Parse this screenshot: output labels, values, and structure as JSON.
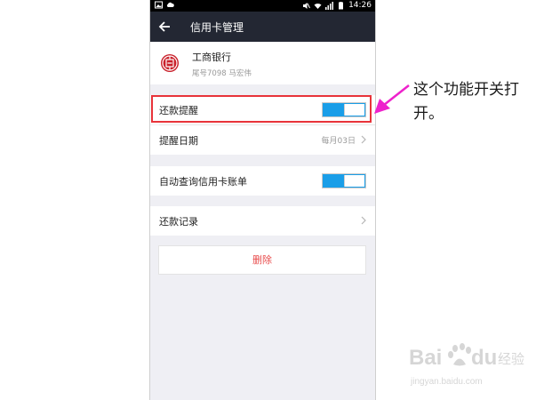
{
  "status_bar": {
    "time": "14:26"
  },
  "header": {
    "title": "信用卡管理"
  },
  "bank": {
    "name": "工商银行",
    "detail": "尾号7098 马宏伟",
    "logo_glyph": "国"
  },
  "settings": {
    "repayment_reminder": {
      "label": "还款提醒",
      "enabled": true
    },
    "reminder_date": {
      "label": "提醒日期",
      "value": "每月03日"
    },
    "auto_query": {
      "label": "自动查询信用卡账单",
      "enabled": true
    },
    "repayment_records": {
      "label": "还款记录"
    }
  },
  "delete_button": {
    "label": "删除"
  },
  "annotation": {
    "text": "这个功能开关打开。"
  },
  "watermark": {
    "brand": "Bai du 经验",
    "url": "jingyan.baidu.com"
  },
  "colors": {
    "accent": "#1a9ee8",
    "titlebar": "#232733",
    "delete": "#e84c4c",
    "highlight": "#e8333a",
    "arrow": "#ee22cc"
  }
}
